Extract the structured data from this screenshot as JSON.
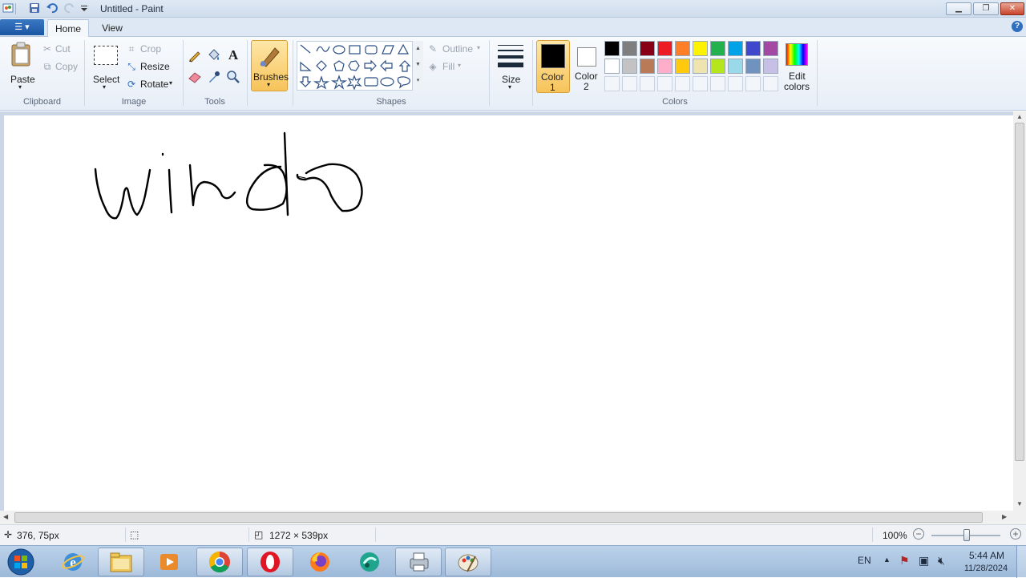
{
  "window": {
    "title": "Untitled - Paint",
    "minimize_icon": "minimize-icon",
    "maximize_icon": "restore-icon",
    "close_icon": "close-icon"
  },
  "quick_access": [
    "paint-app-icon",
    "save-icon",
    "undo-icon",
    "redo-icon",
    "customize-icon"
  ],
  "tabs": [
    {
      "label": "Home",
      "active": true
    },
    {
      "label": "View",
      "active": false
    }
  ],
  "ribbon": {
    "clipboard": {
      "group_label": "Clipboard",
      "paste": "Paste",
      "cut": "Cut",
      "copy": "Copy"
    },
    "image": {
      "group_label": "Image",
      "select": "Select",
      "crop": "Crop",
      "resize": "Resize",
      "rotate": "Rotate"
    },
    "tools": {
      "group_label": "Tools"
    },
    "brushes": {
      "label": "Brushes"
    },
    "shapes": {
      "group_label": "Shapes",
      "outline": "Outline",
      "fill": "Fill"
    },
    "size": {
      "label": "Size"
    },
    "colors": {
      "group_label": "Colors",
      "color1_label": "Color",
      "color1_num": "1",
      "color2_label": "Color",
      "color2_num": "2",
      "edit_label": "Edit",
      "edit_label2": "colors",
      "color1": "#000000",
      "color2": "#ffffff",
      "palette_row1": [
        "#000000",
        "#7f7f7f",
        "#880015",
        "#ed1c24",
        "#ff7f27",
        "#fff200",
        "#22b14c",
        "#00a2e8",
        "#3f48cc",
        "#a349a4"
      ],
      "palette_row2": [
        "#ffffff",
        "#c3c3c3",
        "#b97a57",
        "#ffaec9",
        "#ffc90e",
        "#efe4b0",
        "#b5e61d",
        "#99d9ea",
        "#7092be",
        "#c8bfe7"
      ]
    }
  },
  "canvas": {
    "drawing_text": "windo"
  },
  "status": {
    "cursor_position": "376, 75px",
    "canvas_size": "1272 × 539px",
    "zoom": "100%"
  },
  "taskbar": {
    "apps": [
      "start-orb-icon",
      "internet-explorer-icon",
      "file-explorer-icon",
      "media-player-icon",
      "chrome-icon",
      "opera-icon",
      "firefox-icon",
      "app-icon",
      "printer-app-icon",
      "paint-app-icon"
    ],
    "language": "EN",
    "time": "5:44 AM",
    "date": "11/28/2024"
  }
}
